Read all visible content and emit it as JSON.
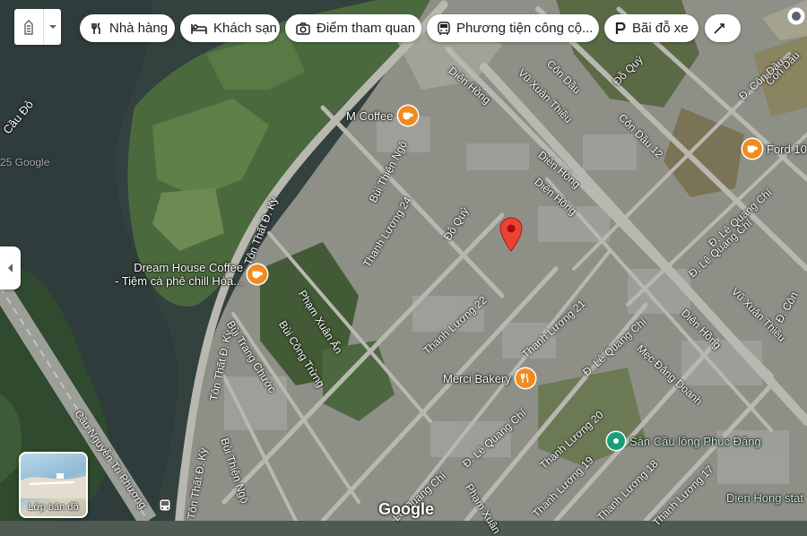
{
  "chips": [
    {
      "label": "Nhà hàng",
      "icon": "restaurant-icon"
    },
    {
      "label": "Khách sạn",
      "icon": "hotel-icon"
    },
    {
      "label": "Điểm tham quan",
      "icon": "camera-icon"
    },
    {
      "label": "Phương tiện công cộ...",
      "icon": "bus-icon"
    },
    {
      "label": "Bãi đỗ xe",
      "icon": "parking-icon"
    }
  ],
  "layer_button": {
    "label": "Lớp bản đồ"
  },
  "attribution": {
    "logo": "Google"
  },
  "water_labels": {
    "cau_do": "Cầu Đỏ",
    "ghost": "25 Google"
  },
  "pois": [
    {
      "name": "M Coffee",
      "type": "cafe",
      "color": "#f28b1e",
      "lines": [
        "M Coffee"
      ]
    },
    {
      "name": "Dream House Coffee",
      "type": "cafe",
      "color": "#f28b1e",
      "lines": [
        "Dream House Coffee",
        "- Tiệm cà phê chill Hòa..."
      ]
    },
    {
      "name": "Merci Bakery",
      "type": "food",
      "color": "#f28b1e",
      "lines": [
        "Merci Bakery"
      ]
    },
    {
      "name": "Sân Cầu lông Phúc Đăng",
      "type": "sports",
      "color": "#1a9e7a",
      "lines": [
        "Sân Cầu lông Phúc Đăng"
      ]
    },
    {
      "name": "Ford 10",
      "type": "cafe",
      "color": "#f28b1e",
      "lines": [
        "Ford 10"
      ]
    },
    {
      "name": "Dien Hong stat",
      "type": "label",
      "color": "#1a9e7a",
      "lines": [
        "Dien Hong stat"
      ]
    }
  ],
  "roads": [
    {
      "name": "Tôn Thất Đ. Kỳ"
    },
    {
      "name": "Tôn Thất Đ. Kỳ"
    },
    {
      "name": "Tôn Thất Đ. Kỳ"
    },
    {
      "name": "Bùi Thiện Ngộ"
    },
    {
      "name": "Bùi Thiện Ngộ"
    },
    {
      "name": "Thanh Lương 24"
    },
    {
      "name": "Đỗ Quý"
    },
    {
      "name": "Phạm Xuân Ẩn"
    },
    {
      "name": "Bùi Công Trừng"
    },
    {
      "name": "Bùi Trang Chước"
    },
    {
      "name": "Thanh Lương 22"
    },
    {
      "name": "Thanh Lương 21"
    },
    {
      "name": "Thanh Lương 20"
    },
    {
      "name": "Thanh Lương 19"
    },
    {
      "name": "Thanh Lương 18"
    },
    {
      "name": "Thanh Lương 17"
    },
    {
      "name": "Đ. Lê Quang Chí"
    },
    {
      "name": "Đ. Lê Quang Chí"
    },
    {
      "name": "Đ. Lê Quang Chí"
    },
    {
      "name": "Lê Quang Chí"
    },
    {
      "name": "Mẹc Đăng Doanh"
    },
    {
      "name": "Diên Hồng"
    },
    {
      "name": "Diên Hồng"
    },
    {
      "name": "Diên Hồng"
    },
    {
      "name": "Diên Hồng"
    },
    {
      "name": "Vũ Xuân Thiều"
    },
    {
      "name": "Vũ Xuân Thiều"
    },
    {
      "name": "Côn Dầu 12"
    },
    {
      "name": "Côn Dầu"
    },
    {
      "name": "Côn Dầu"
    },
    {
      "name": "Đỗ Quý"
    },
    {
      "name": "Đ. Côn Dầu"
    },
    {
      "name": "Đ. Lê Quang Chí"
    },
    {
      "name": "Cầu Nguyễn Tri Phương"
    },
    {
      "name": "Phạm Xuân"
    },
    {
      "name": "Đ. Côn"
    }
  ]
}
